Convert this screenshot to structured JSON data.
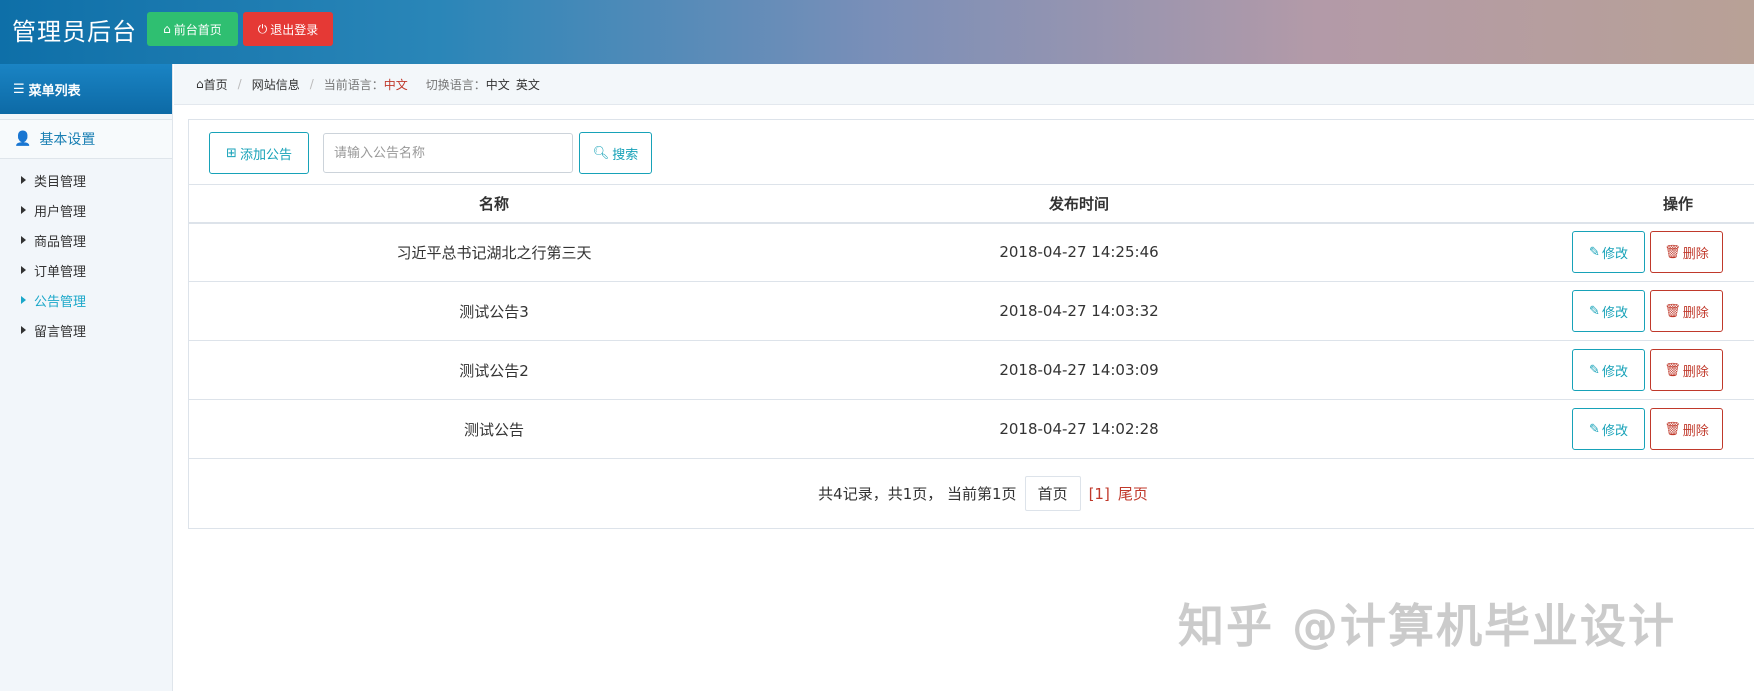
{
  "header": {
    "title": "管理员后台",
    "front_label": "前台首页",
    "logout_label": "退出登录"
  },
  "sidebar": {
    "menu_title": "菜单列表",
    "group_label": "基本设置",
    "items": [
      {
        "label": "类目管理"
      },
      {
        "label": "用户管理"
      },
      {
        "label": "商品管理"
      },
      {
        "label": "订单管理"
      },
      {
        "label": "公告管理"
      },
      {
        "label": "留言管理"
      }
    ],
    "active_index": 4
  },
  "breadcrumb": {
    "home": "首页",
    "site_info": "网站信息",
    "current_lang_label": "当前语言：",
    "current_lang": "中文",
    "switch_label": "切换语言：",
    "lang_cn": "中文",
    "lang_en": "英文"
  },
  "toolbar": {
    "add_label": "添加公告",
    "search_placeholder": "请输入公告名称",
    "search_label": "搜索"
  },
  "table": {
    "headers": [
      "名称",
      "发布时间",
      "操作"
    ],
    "rows": [
      {
        "name": "习近平总书记湖北之行第三天",
        "time": "2018-04-27 14:25:46"
      },
      {
        "name": "测试公告3",
        "time": "2018-04-27 14:03:32"
      },
      {
        "name": "测试公告2",
        "time": "2018-04-27 14:03:09"
      },
      {
        "name": "测试公告",
        "time": "2018-04-27 14:02:28"
      }
    ],
    "edit_label": "修改",
    "delete_label": "删除"
  },
  "pager": {
    "summary": "共4记录，共1页， 当前第1页",
    "first": "首页",
    "current": "[1]",
    "last": "尾页"
  },
  "watermark": "知乎 @计算机毕业设计",
  "colors": {
    "accent": "#17a2b8",
    "danger": "#c0392b",
    "success": "#2fbf71",
    "logout": "#e53935"
  }
}
